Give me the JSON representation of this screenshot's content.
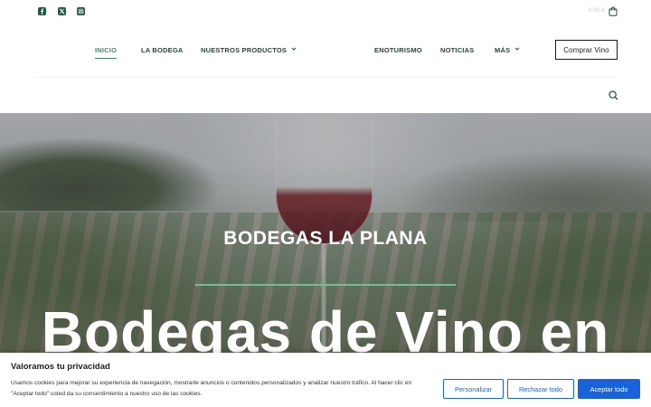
{
  "topbar": {
    "social_icons": [
      "facebook-icon",
      "x-twitter-icon",
      "instagram-icon"
    ],
    "cart_price": "0,00 €",
    "cart_icon": "shopping-bag-icon"
  },
  "nav": {
    "items": [
      {
        "label": "INICIO",
        "active": true
      },
      {
        "label": "LA BODEGA"
      },
      {
        "label": "NUESTROS PRODUCTOS",
        "has_dropdown": true
      },
      {
        "label": "ENOTURISMO"
      },
      {
        "label": "NOTICIAS"
      },
      {
        "label": "MÁS",
        "has_dropdown": true
      }
    ],
    "cta_label": "Comprar Vino",
    "search_icon": "search-icon"
  },
  "hero": {
    "subtitle": "BODEGAS LA PLANA",
    "title": "Bodegas de Vino en"
  },
  "cookie_banner": {
    "title": "Valoramos tu privacidad",
    "text": "Usamos cookies para mejorar su experiencia de navegación, mostrarle anuncios o contenidos personalizados y analizar nuestro tráfico. Al hacer clic en \"Aceptar todo\" usted da su consentimiento a nuestro uso de las cookies.",
    "customize_label": "Personalizar",
    "reject_label": "Rechazar todo",
    "accept_label": "Aceptar todo"
  },
  "colors": {
    "brand_green": "#1f4a3a",
    "active_green": "#3e8d6e",
    "accent_line": "#6dbf96",
    "cookie_blue": "#1863dc"
  }
}
